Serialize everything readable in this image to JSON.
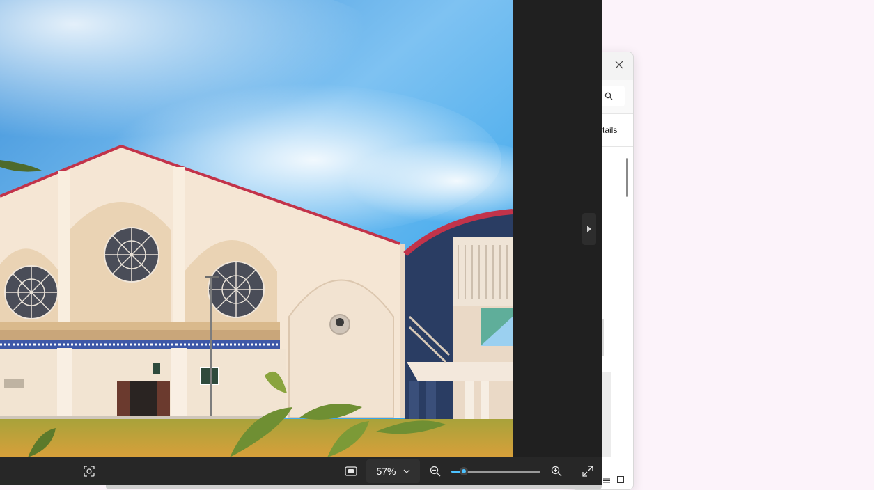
{
  "background_window": {
    "close_icon": "close-icon",
    "search_icon": "search-icon",
    "details_label": "tails",
    "view_icons": [
      "details-view-icon",
      "tiles-view-icon"
    ]
  },
  "photos_app": {
    "photo": {
      "description_icon": "image",
      "sky_color": "#4fb0ef",
      "building_color": "#f4e4d0",
      "roof_trim_color": "#c0394e",
      "grass_color": "#c9a43c"
    },
    "next_icon": "chevron-right-icon",
    "toolbar": {
      "visual_search_icon": "visual-search-icon",
      "fit_icon": "fit-to-window-icon",
      "zoom_level": "57%",
      "zoom_dropdown_icon": "chevron-down-icon",
      "zoom_out_icon": "zoom-out-icon",
      "zoom_in_icon": "zoom-in-icon",
      "fullscreen_icon": "fullscreen-icon",
      "zoom_slider_fraction": 0.1
    },
    "accent_color": "#4cc2ff"
  }
}
